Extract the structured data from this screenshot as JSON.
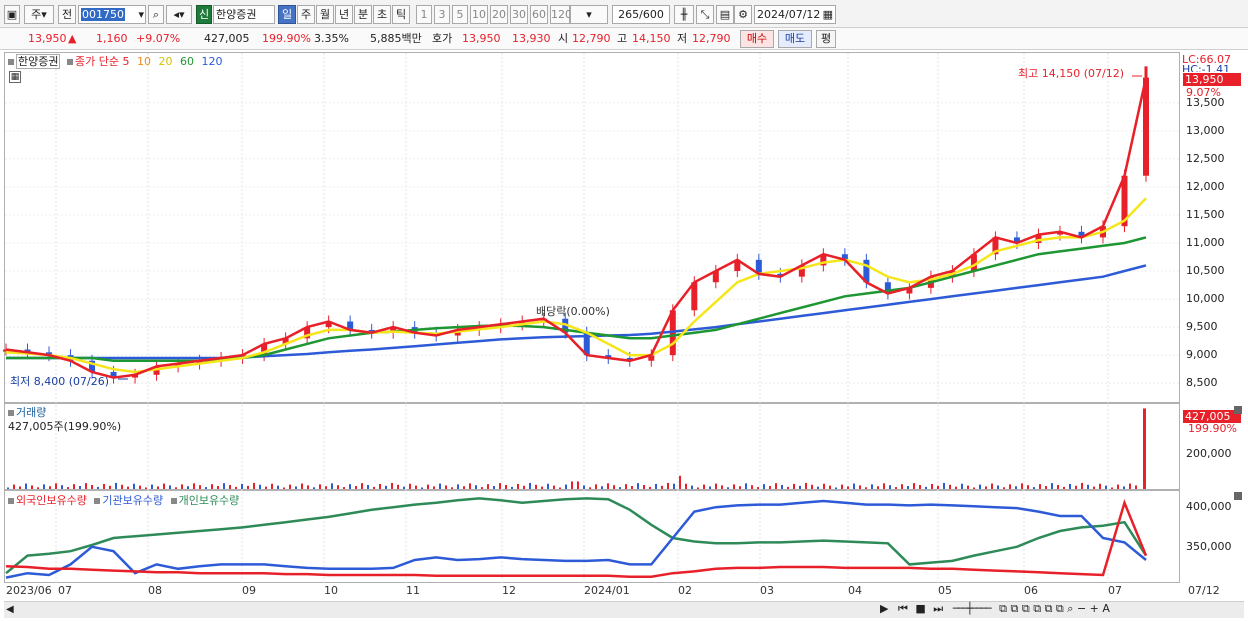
{
  "toolbar": {
    "period_select": "주",
    "prev_label": "전",
    "code_value": "001750",
    "badge_label": "신",
    "stock_name": "한양증권",
    "period_tabs": [
      "일",
      "주",
      "월",
      "년",
      "분",
      "초",
      "틱"
    ],
    "interval_buttons": [
      "1",
      "3",
      "5",
      "10",
      "20",
      "30",
      "60",
      "120"
    ],
    "count_value": "265",
    "count_total": "/600",
    "date_value": "2024/07/12"
  },
  "infobar": {
    "price": "13,950",
    "change_arrow": "▲",
    "change": "1,160",
    "change_pct": "+9.07%",
    "volume": "427,005",
    "volume_ratio": "199.90%",
    "turnover": "3.35%",
    "amount": "5,885백만",
    "quote_label": "호가",
    "ask": "13,950",
    "bid": "13,930",
    "open_label": "시",
    "open": "12,790",
    "high_label": "고",
    "high": "14,150",
    "low_label": "저",
    "low": "12,790",
    "buy_button": "매수",
    "sell_button": "매도",
    "eval_button": "평"
  },
  "price_panel": {
    "legend_name": "한양증권",
    "legend_series": "종가 단순",
    "ma_periods": [
      "5",
      "10",
      "20",
      "60",
      "120"
    ],
    "ma_colors": [
      "#e8202a",
      "#f08c1e",
      "#f5e61a",
      "#1e9632",
      "#2d5ad7"
    ],
    "high_annotation": "최고 14,150 (07/12)",
    "low_annotation": "최저 8,400 (07/26)",
    "dividend_annotation": "배당락(0.00%)",
    "lc_label": "LC:66.07",
    "hc_label": "HC:-1.41",
    "current_price_badge": "13,950",
    "current_pct_badge": "9.07%",
    "y_ticks": [
      "13,500",
      "13,000",
      "12,500",
      "12,000",
      "11,500",
      "11,000",
      "10,500",
      "10,000",
      "9,500",
      "9,000",
      "8,500"
    ]
  },
  "volume_panel": {
    "legend": "거래량",
    "value_text": "427,005주(199.90%)",
    "badge_volume": "427,005",
    "badge_pct": "199.90%",
    "y_ticks": [
      "200,000"
    ]
  },
  "holding_panel": {
    "legend_items": [
      {
        "label": "외국인보유수량",
        "color": "#e8202a"
      },
      {
        "label": "기관보유수량",
        "color": "#2d5ad7"
      },
      {
        "label": "개인보유수량",
        "color": "#2e8b57"
      }
    ],
    "y_ticks": [
      "400,000",
      "350,000"
    ]
  },
  "x_axis": {
    "labels": [
      "2023/06",
      "07",
      "08",
      "09",
      "10",
      "11",
      "12",
      "2024/01",
      "02",
      "03",
      "04",
      "05",
      "06",
      "07"
    ],
    "right_label": "07/12"
  },
  "chart_data": {
    "type": "candlestick",
    "price": {
      "ylim": [
        8200,
        14300
      ],
      "close_path_weeks": 54,
      "ma5": [
        9100,
        9050,
        9000,
        8900,
        8700,
        8600,
        8650,
        8800,
        8850,
        8900,
        8950,
        9000,
        9200,
        9300,
        9500,
        9600,
        9450,
        9400,
        9500,
        9400,
        9350,
        9450,
        9500,
        9550,
        9600,
        9650,
        9400,
        9000,
        8950,
        8900,
        9000,
        9800,
        10300,
        10500,
        10700,
        10450,
        10400,
        10600,
        10800,
        10700,
        10300,
        10100,
        10200,
        10400,
        10500,
        10800,
        11100,
        11000,
        11150,
        11200,
        11100,
        11300,
        12200,
        13950
      ],
      "ma20": [
        9050,
        9030,
        9000,
        8950,
        8850,
        8750,
        8700,
        8750,
        8800,
        8850,
        8900,
        8950,
        9050,
        9200,
        9350,
        9450,
        9450,
        9400,
        9420,
        9400,
        9380,
        9420,
        9460,
        9500,
        9550,
        9600,
        9550,
        9400,
        9200,
        9000,
        9000,
        9200,
        9600,
        9950,
        10300,
        10450,
        10500,
        10550,
        10650,
        10700,
        10600,
        10400,
        10300,
        10350,
        10450,
        10600,
        10850,
        10950,
        11050,
        11100,
        11100,
        11200,
        11400,
        11800
      ],
      "ma60": [
        8950,
        8950,
        8950,
        8950,
        8950,
        8900,
        8900,
        8900,
        8900,
        8900,
        8920,
        8950,
        9000,
        9100,
        9200,
        9300,
        9350,
        9400,
        9420,
        9450,
        9480,
        9500,
        9520,
        9530,
        9520,
        9500,
        9450,
        9400,
        9350,
        9300,
        9300,
        9350,
        9400,
        9450,
        9550,
        9650,
        9750,
        9850,
        9950,
        10050,
        10100,
        10150,
        10200,
        10300,
        10400,
        10500,
        10600,
        10700,
        10800,
        10850,
        10900,
        10950,
        11000,
        11100
      ],
      "ma120": [
        8950,
        8950,
        8950,
        8950,
        8950,
        8950,
        8950,
        8950,
        8950,
        8950,
        8950,
        8960,
        8980,
        9000,
        9020,
        9050,
        9080,
        9100,
        9130,
        9160,
        9190,
        9220,
        9250,
        9280,
        9300,
        9320,
        9330,
        9340,
        9350,
        9360,
        9380,
        9420,
        9460,
        9500,
        9550,
        9600,
        9650,
        9700,
        9750,
        9800,
        9850,
        9900,
        9950,
        10000,
        10050,
        10100,
        10150,
        10200,
        10250,
        10300,
        10350,
        10400,
        10500,
        10600
      ]
    },
    "volume": {
      "ylim": [
        0,
        440000
      ],
      "latest": 427005
    },
    "holdings": {
      "ylim": [
        310000,
        410000
      ],
      "foreign": [
        328000,
        327000,
        325000,
        325000,
        324000,
        323000,
        322000,
        321000,
        321000,
        320000,
        320000,
        320000,
        320000,
        319000,
        319000,
        318000,
        318000,
        318000,
        318000,
        318000,
        317000,
        317000,
        317000,
        317000,
        317000,
        317000,
        317000,
        317000,
        317000,
        316000,
        316000,
        320000,
        322000,
        325000,
        326000,
        326000,
        327000,
        327000,
        327000,
        326000,
        326000,
        326000,
        326000,
        325000,
        325000,
        324000,
        323000,
        322000,
        321000,
        320000,
        319000,
        318000,
        400000,
        340000
      ],
      "institution": [
        315000,
        320000,
        318000,
        330000,
        350000,
        345000,
        320000,
        330000,
        325000,
        328000,
        330000,
        330000,
        330000,
        328000,
        326000,
        325000,
        325000,
        325000,
        326000,
        335000,
        338000,
        335000,
        336000,
        338000,
        336000,
        335000,
        334000,
        334000,
        335000,
        330000,
        330000,
        360000,
        390000,
        395000,
        397000,
        398000,
        398000,
        400000,
        402000,
        400000,
        398000,
        398000,
        397000,
        398000,
        397000,
        396000,
        395000,
        394000,
        390000,
        385000,
        385000,
        360000,
        355000,
        335000
      ],
      "individual": [
        320000,
        340000,
        342000,
        345000,
        352000,
        360000,
        362000,
        364000,
        366000,
        368000,
        370000,
        372000,
        375000,
        378000,
        381000,
        384000,
        388000,
        392000,
        395000,
        398000,
        400000,
        403000,
        405000,
        403000,
        400000,
        402000,
        404000,
        405000,
        404000,
        392000,
        375000,
        360000,
        356000,
        354000,
        354000,
        355000,
        355000,
        356000,
        357000,
        356000,
        355000,
        354000,
        330000,
        332000,
        334000,
        340000,
        345000,
        350000,
        360000,
        368000,
        372000,
        374000,
        378000,
        340000
      ]
    }
  }
}
